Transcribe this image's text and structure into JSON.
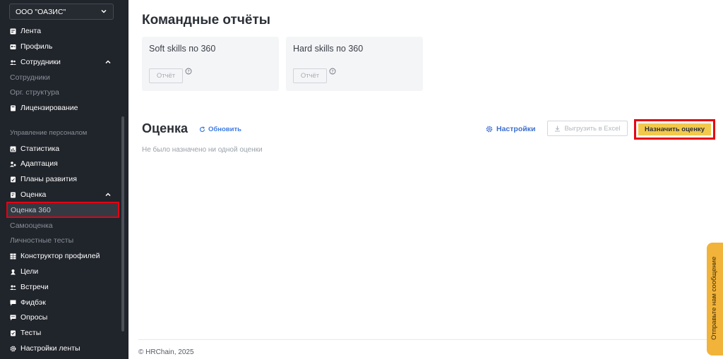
{
  "sidebar": {
    "org_name": "ООО \"ОАЗИС\"",
    "items_top": [
      {
        "label": "Лента",
        "icon": "feed-icon"
      },
      {
        "label": "Профиль",
        "icon": "profile-icon"
      },
      {
        "label": "Сотрудники",
        "icon": "users-icon"
      }
    ],
    "employees_sub": [
      "Сотрудники",
      "Орг. структура"
    ],
    "licensing": "Лицензирование",
    "section_label": "Управление персоналом",
    "items_mid": [
      {
        "label": "Статистика",
        "icon": "chart-icon"
      },
      {
        "label": "Адаптация",
        "icon": "adaptation-icon"
      },
      {
        "label": "Планы развития",
        "icon": "plans-icon"
      },
      {
        "label": "Оценка",
        "icon": "assessment-icon"
      }
    ],
    "assessment_sub": [
      "Оценка 360",
      "Самооценка",
      "Личностные тесты"
    ],
    "items_bottom": [
      {
        "label": "Конструктор профилей",
        "icon": "grid-icon"
      },
      {
        "label": "Цели",
        "icon": "goal-icon"
      },
      {
        "label": "Встречи",
        "icon": "meetings-icon"
      },
      {
        "label": "Фидбэк",
        "icon": "feedback-icon"
      },
      {
        "label": "Опросы",
        "icon": "survey-icon"
      },
      {
        "label": "Тесты",
        "icon": "tests-icon"
      },
      {
        "label": "Настройки ленты",
        "icon": "gear-icon"
      }
    ]
  },
  "main": {
    "title": "Командные отчёты",
    "report_cards": [
      {
        "title": "Soft skills по 360",
        "button": "Отчёт"
      },
      {
        "title": "Hard skills по 360",
        "button": "Отчёт"
      }
    ],
    "assessment": {
      "title": "Оценка",
      "refresh": "Обновить",
      "settings": "Настройки",
      "export": "Выгрузить в Excel",
      "assign": "Назначить оценку",
      "empty": "Не было назначено ни одной оценки"
    },
    "footer": "© HRChain, 2025"
  },
  "widget": {
    "label": "Отправьте нам сообщение"
  },
  "colors": {
    "sidebar_bg": "#20242b",
    "accent_yellow": "#f2c94c",
    "link_blue": "#3d7be0",
    "highlight_red": "#e60012"
  }
}
